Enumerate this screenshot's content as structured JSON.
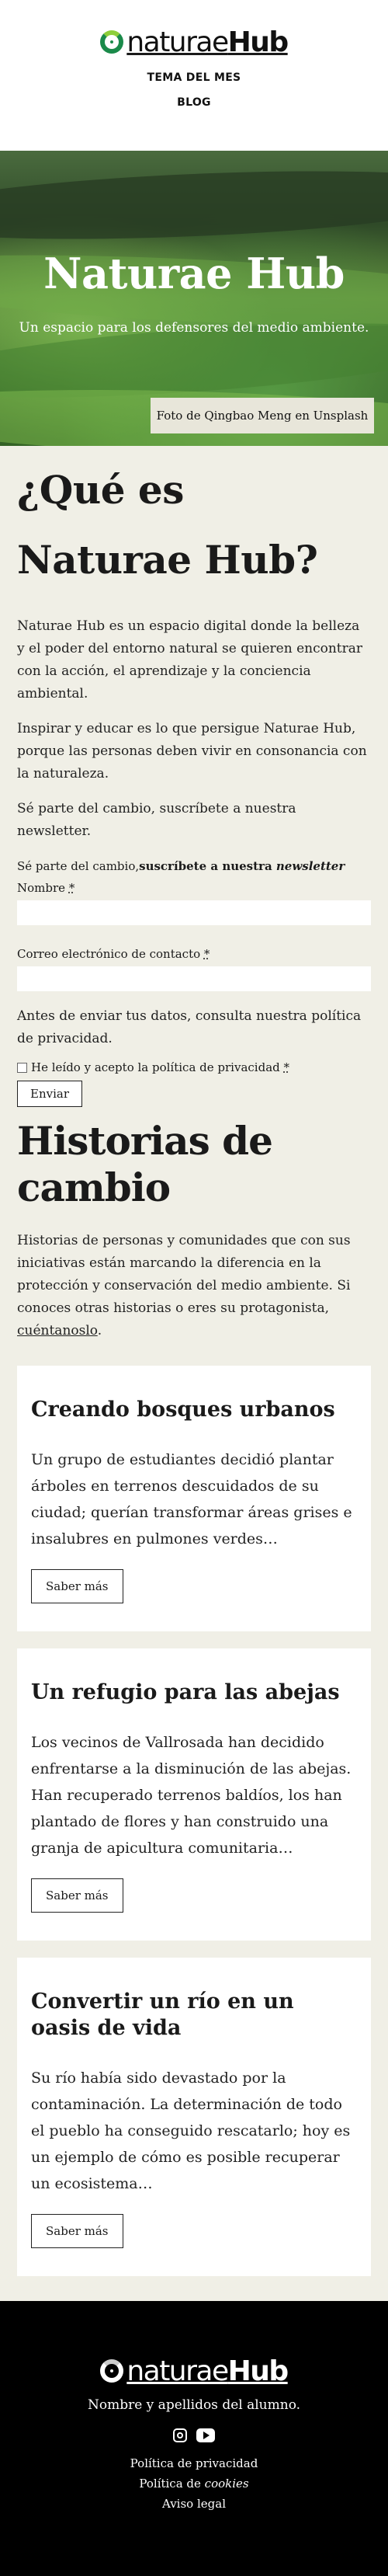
{
  "header": {
    "logo_light": "naturae",
    "logo_bold": "Hub",
    "nav": [
      "TEMA DEL MES",
      "BLOG"
    ]
  },
  "hero": {
    "title": "Naturae Hub",
    "subtitle": "Un espacio para los defensores del medio ambiente.",
    "credit": "Foto de Qingbao Meng en Unsplash"
  },
  "about": {
    "title": "¿Qué es Naturae Hub?",
    "paragraphs": [
      "Naturae Hub es un espacio digital donde la belleza y el poder del entorno natural se quieren encontrar con la acción, el aprendizaje y la conciencia ambiental.",
      "Inspirar y educar es lo que persigue Naturae Hub, porque las personas deben vivir en consonancia con la naturaleza.",
      "Sé parte del cambio, suscríbete a nuestra newsletter."
    ]
  },
  "form": {
    "intro_prefix": "Sé parte del cambio,",
    "intro_bold": "suscríbete a nuestra ",
    "intro_em": "newsletter",
    "name_label": "Nombre",
    "email_label": "Correo electrónico de contacto",
    "required_mark": "*",
    "privacy_text": "Antes de enviar tus datos, consulta nuestra política de privacidad.",
    "consent_label": "He leído y acepto la política de privacidad",
    "submit_label": "Enviar"
  },
  "stories": {
    "title": "Historias de cambio",
    "intro": "Historias de personas y comunidades que con sus iniciativas están marcando la diferencia en la protección y conservación del medio ambiente. Si conoces otras historias o eres su protagonista,",
    "intro_link": "cuéntanoslo",
    "intro_end": ".",
    "cards": [
      {
        "title": "Creando bosques urbanos",
        "text": "Un grupo de estudiantes decidió plantar árboles en terrenos descuidados de su ciudad; querían transformar áreas grises e insalubres en pulmones verdes…",
        "button": "Saber más"
      },
      {
        "title": "Un refugio para las abejas",
        "text": "Los vecinos de Vallrosada han decidido enfrentarse a la disminución de las abejas. Han recuperado terrenos baldíos, los han plantado de flores y han construido una granja de apicultura comunitaria…",
        "button": "Saber más"
      },
      {
        "title": "Convertir un río en un oasis de vida",
        "text": "Su río había sido devastado por la contaminación. La determinación de todo el pueblo ha conseguido rescatarlo; hoy es un ejemplo de cómo es posible recuperar un ecosistema…",
        "button": "Saber más"
      }
    ]
  },
  "footer": {
    "logo_light": "naturae",
    "logo_bold": "Hub",
    "tagline": "Nombre y apellidos del alumno.",
    "links": [
      "Política de privacidad",
      "Política de ",
      "Aviso legal"
    ],
    "cookies_em": "cookies"
  },
  "colors": {
    "page_bg": "#f0efe6",
    "logo_green": "#1a8a4a",
    "footer_bg": "#000000"
  }
}
